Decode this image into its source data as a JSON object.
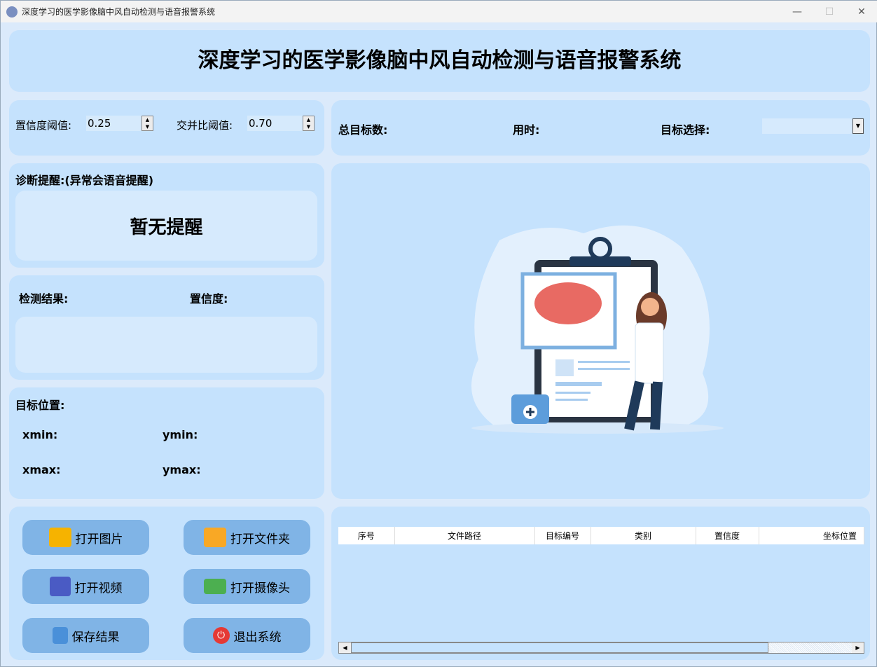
{
  "window": {
    "title": "深度学习的医学影像脑中风自动检测与语音报警系统"
  },
  "header": {
    "title": "深度学习的医学影像脑中风自动检测与语音报警系统"
  },
  "params": {
    "conf_label": "置信度阈值:",
    "conf_value": "0.25",
    "iou_label": "交并比阈值:",
    "iou_value": "0.70"
  },
  "stats": {
    "total_label": "总目标数:",
    "time_label": "用时:",
    "select_label": "目标选择:",
    "select_value": ""
  },
  "alert": {
    "title": "诊断提醒:(异常会语音提醒)",
    "message": "暂无提醒"
  },
  "result": {
    "result_label": "检测结果:",
    "conf_label": "置信度:"
  },
  "position": {
    "title": "目标位置:",
    "xmin": "xmin:",
    "ymin": "ymin:",
    "xmax": "xmax:",
    "ymax": "ymax:"
  },
  "buttons": {
    "open_image": "打开图片",
    "open_folder": "打开文件夹",
    "open_video": "打开视频",
    "open_camera": "打开摄像头",
    "save": "保存结果",
    "exit": "退出系统"
  },
  "table": {
    "columns": [
      "序号",
      "文件路径",
      "目标编号",
      "类别",
      "置信度",
      "坐标位置"
    ],
    "rows": []
  }
}
